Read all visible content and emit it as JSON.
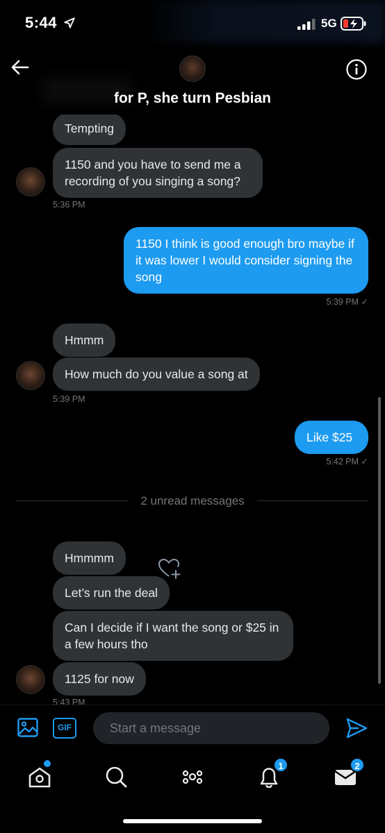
{
  "status_bar": {
    "time": "5:44",
    "network": "5G"
  },
  "header": {
    "title": "for P, she turn Pesbian"
  },
  "messages": {
    "m1": "Tempting",
    "m2": "1150 and you have to send me a recording of you singing a song?",
    "t1": "5:36 PM",
    "m3": "1150 I think is good enough bro maybe if it was lower I would consider signing the song",
    "t2": "5:39 PM ✓",
    "m4": "Hmmm",
    "m5": "How much do you value a song at",
    "t3": "5:39 PM",
    "m6": "Like $25",
    "t4": "5:42 PM ✓",
    "unread_divider": "2 unread messages",
    "m7": "Hmmmm",
    "m8": "Let’s run the deal",
    "m9": "Can I decide if I want the song or $25 in a few hours tho",
    "m10": "1125 for now",
    "t5": "5:43 PM"
  },
  "composer": {
    "gif_label": "GIF",
    "placeholder": "Start a message"
  },
  "tabbar": {
    "notifications_badge": "1",
    "messages_badge": "2"
  },
  "colors": {
    "accent": "#1d9bf0",
    "incoming_bubble": "#2f3336",
    "background": "#000000"
  },
  "icons": [
    "location-arrow-icon",
    "signal-icon",
    "battery-icon",
    "back-arrow-icon",
    "info-icon",
    "image-icon",
    "gif-icon",
    "send-icon",
    "home-icon",
    "search-icon",
    "spaces-icon",
    "bell-icon",
    "mail-icon",
    "add-reaction-icon"
  ]
}
